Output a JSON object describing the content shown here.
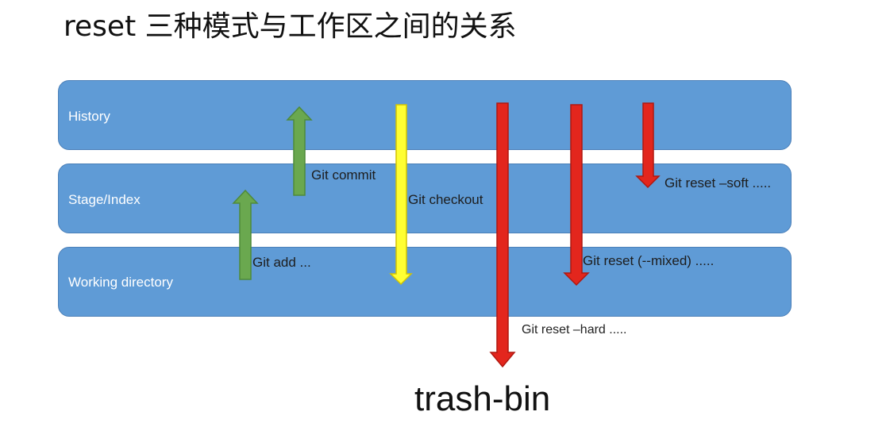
{
  "title": "reset 三种模式与工作区之间的关系",
  "bands": {
    "history": "History",
    "stage": "Stage/Index",
    "working": "Working directory"
  },
  "arrows": {
    "commit": "Git commit",
    "add": "Git add ...",
    "checkout": "Git checkout",
    "reset_soft": "Git reset –soft .....",
    "reset_mixed": "Git reset (--mixed) .....",
    "reset_hard": "Git reset –hard ....."
  },
  "trash_bin": "trash-bin",
  "colors": {
    "band": "#5f9bd6",
    "green": "#6aa84f",
    "yellow": "#ffff33",
    "red": "#e3261d"
  }
}
